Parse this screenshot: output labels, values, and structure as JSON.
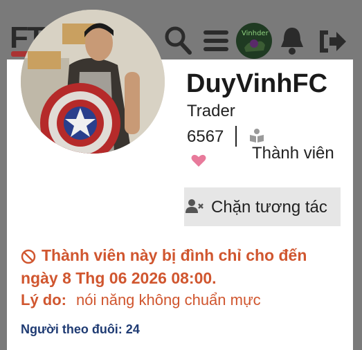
{
  "nav": {
    "logo_text": "FT",
    "avatar_text": "Vinhder",
    "icons": [
      "search-icon",
      "menu-icon",
      "bell-icon",
      "logout-icon"
    ]
  },
  "profile": {
    "username": "DuyVinhFC",
    "role": "Trader",
    "count": "6567",
    "member_label": "Thành viên",
    "block_button_label": "Chặn tương tác"
  },
  "ban": {
    "line1": "Thành viên này bị đình chỉ cho đến",
    "line2": "ngày 8 Thg 06 2026 08:00.",
    "reason_label": "Lý do:",
    "reason_text": "nói năng không chuẩn mực"
  },
  "followers": {
    "text": "Người theo đuôi: 24"
  },
  "colors": {
    "warning": "#d0562f",
    "followers": "#1f3b73",
    "heart": "#e87a9b",
    "button_bg": "#e6e6e6"
  }
}
